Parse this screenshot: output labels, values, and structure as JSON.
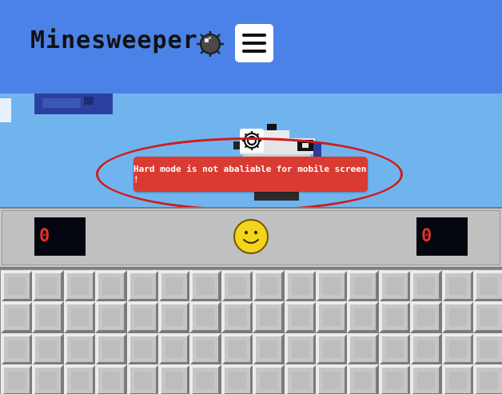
{
  "header": {
    "title": "Minesweeper",
    "logo_icon": "mine-icon",
    "menu_icon": "hamburger-menu-icon"
  },
  "scene": {
    "settings_icon": "gear-icon"
  },
  "alert": {
    "message": "Hard mode is not abaliable for mobile screen !"
  },
  "game": {
    "mines_counter": "0",
    "timer": "0",
    "reset_icon": "smiley-face-icon",
    "grid": {
      "cols": 16,
      "visible_rows": 4
    }
  },
  "colors": {
    "navbar": "#4b82e8",
    "sky": "#70b4ee",
    "alert": "#d93b33",
    "highlight": "#d11a1a",
    "counter_bg": "#04060f",
    "counter_digit": "#e0322a",
    "smiley": "#f4d51c"
  }
}
